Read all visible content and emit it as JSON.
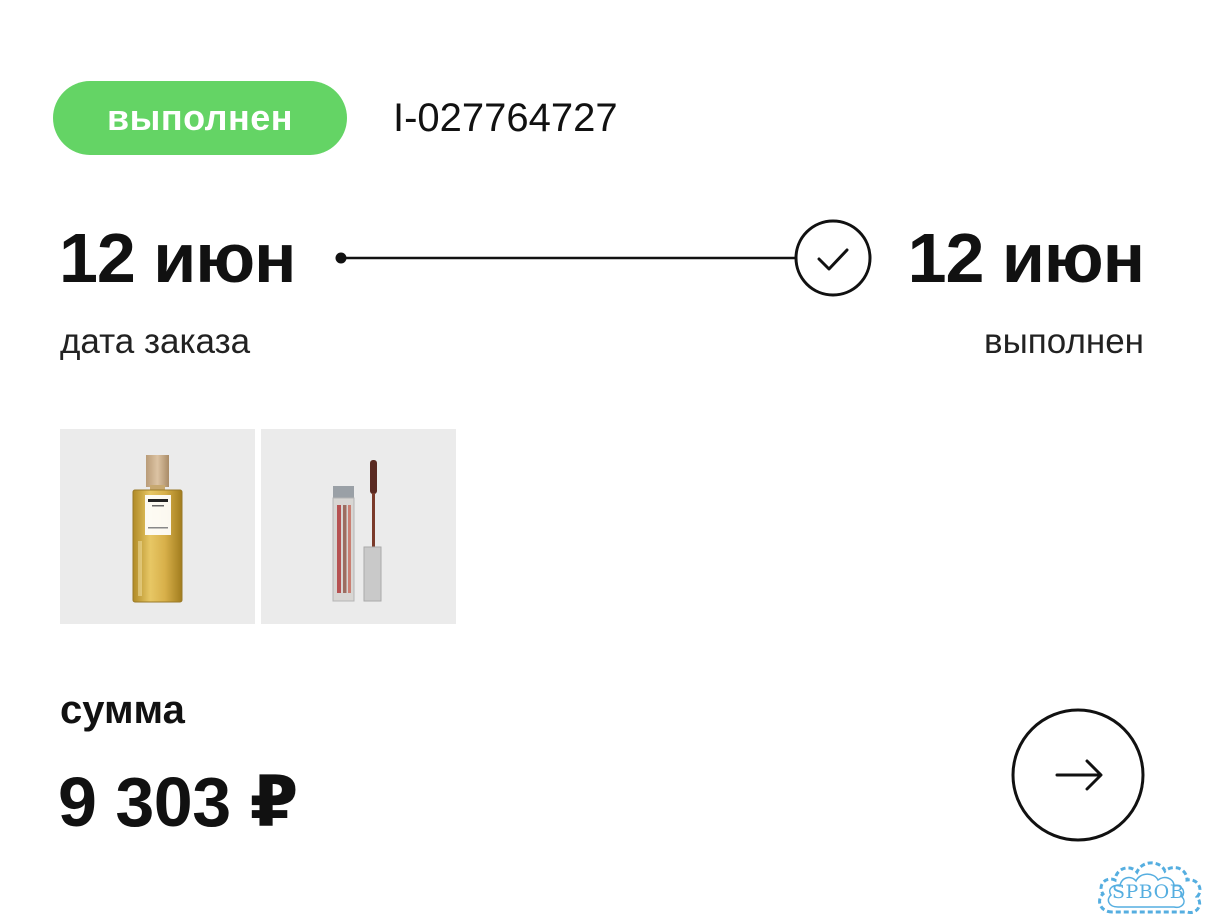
{
  "order": {
    "status": "выполнен",
    "status_color": "#64d465",
    "id": "I-027764727"
  },
  "timeline": {
    "start_date": "12 июн",
    "start_label": "дата заказа",
    "end_date": "12 июн",
    "end_label": "выполнен",
    "end_icon": "check-circle-icon"
  },
  "products": [
    {
      "name": "perfume-bottle",
      "icon": "perfume-image"
    },
    {
      "name": "mascara-tube",
      "icon": "mascara-image"
    }
  ],
  "summary": {
    "label": "сумма",
    "value": "9 303 ₽"
  },
  "actions": {
    "open_icon": "arrow-right-icon"
  },
  "watermark": {
    "text": "SPBOB",
    "color": "#55aee0"
  }
}
